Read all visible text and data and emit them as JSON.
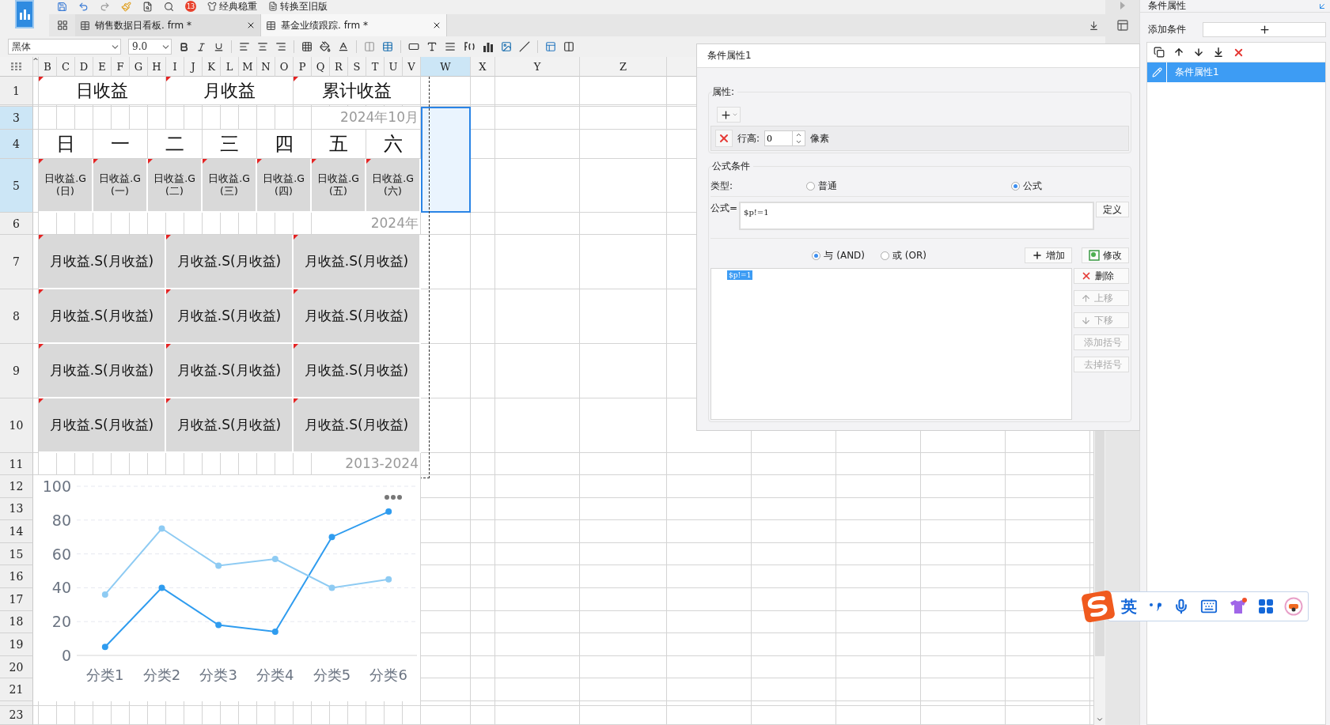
{
  "app_toolbar": {
    "badge": "13",
    "theme_button": "经典稳重",
    "legacy_button": "转换至旧版"
  },
  "tabs": [
    {
      "label": "销售数据日看板. frm *",
      "selected": false
    },
    {
      "label": "基金业绩跟踪. frm *",
      "selected": true
    }
  ],
  "format_toolbar": {
    "font": "黑体",
    "size": "9.0"
  },
  "sheet": {
    "columns": [
      {
        "label": "^",
        "selected": false
      },
      {
        "label": "B",
        "selected": false
      },
      {
        "label": "C",
        "selected": false
      },
      {
        "label": "D",
        "selected": false
      },
      {
        "label": "E",
        "selected": false
      },
      {
        "label": "F",
        "selected": false
      },
      {
        "label": "G",
        "selected": false
      },
      {
        "label": "H",
        "selected": false
      },
      {
        "label": "I",
        "selected": false
      },
      {
        "label": "J",
        "selected": false
      },
      {
        "label": "K",
        "selected": false
      },
      {
        "label": "L",
        "selected": false
      },
      {
        "label": "M",
        "selected": false
      },
      {
        "label": "N",
        "selected": false
      },
      {
        "label": "O",
        "selected": false
      },
      {
        "label": "P",
        "selected": false
      },
      {
        "label": "Q",
        "selected": false
      },
      {
        "label": "R",
        "selected": false
      },
      {
        "label": "S",
        "selected": false
      },
      {
        "label": "T",
        "selected": false
      },
      {
        "label": "U",
        "selected": false
      },
      {
        "label": "V",
        "selected": false
      },
      {
        "label": "W",
        "selected": true
      },
      {
        "label": "X",
        "selected": false
      },
      {
        "label": "Y",
        "selected": false
      },
      {
        "label": "Z",
        "selected": false
      }
    ],
    "rows": [
      {
        "label": "1",
        "selected": false
      },
      {
        "label": "3",
        "selected": true
      },
      {
        "label": "4",
        "selected": true
      },
      {
        "label": "5",
        "selected": true
      },
      {
        "label": "6",
        "selected": false
      },
      {
        "label": "7",
        "selected": false
      },
      {
        "label": "8",
        "selected": false
      },
      {
        "label": "9",
        "selected": false
      },
      {
        "label": "10",
        "selected": false
      },
      {
        "label": "11",
        "selected": false
      },
      {
        "label": "12",
        "selected": false
      },
      {
        "label": "13",
        "selected": false
      },
      {
        "label": "14",
        "selected": false
      },
      {
        "label": "15",
        "selected": false
      },
      {
        "label": "16",
        "selected": false
      },
      {
        "label": "17",
        "selected": false
      },
      {
        "label": "18",
        "selected": false
      },
      {
        "label": "19",
        "selected": false
      },
      {
        "label": "20",
        "selected": false
      },
      {
        "label": "21",
        "selected": false
      },
      {
        "label": "23",
        "selected": false
      }
    ],
    "titles": [
      "日收益",
      "月收益",
      "累计收益"
    ],
    "month_label": "2024年10月",
    "weekdays": [
      "日",
      "一",
      "二",
      "三",
      "四",
      "五",
      "六"
    ],
    "daily_cells": [
      "日收益.G(日)",
      "日收益.G(一)",
      "日收益.G(二)",
      "日收益.G(三)",
      "日收益.G(四)",
      "日收益.G(五)",
      "日收益.G(六)"
    ],
    "year_label": "2024年",
    "monthly_rows": [
      [
        "月收益.S(月收益)",
        "月收益.S(月收益)",
        "月收益.S(月收益)"
      ],
      [
        "月收益.S(月收益)",
        "月收益.S(月收益)",
        "月收益.S(月收益)"
      ],
      [
        "月收益.S(月收益)",
        "月收益.S(月收益)",
        "月收益.S(月收益)"
      ],
      [
        "月收益.S(月收益)",
        "月收益.S(月收益)",
        "月收益.S(月收益)"
      ]
    ],
    "range_label": "2013-2024",
    "chart_data": {
      "type": "line",
      "categories": [
        "分类1",
        "分类2",
        "分类3",
        "分类4",
        "分类5",
        "分类6"
      ],
      "series": [
        {
          "color": "#2f9cef",
          "marker": "circle",
          "values": [
            5,
            40,
            18,
            14,
            70,
            85
          ]
        },
        {
          "color": "#8ecbf3",
          "marker": "circle",
          "values": [
            36,
            75,
            53,
            57,
            40,
            45
          ]
        }
      ],
      "grid": true,
      "ylim": [
        0,
        100
      ],
      "yticks": [
        0,
        20,
        40,
        60,
        80,
        100
      ]
    }
  },
  "dialog": {
    "title": "条件属性1",
    "attributes_legend": "属性:",
    "row_height_label": "行高:",
    "row_height_value": "0",
    "row_height_unit": "像素",
    "formula_legend": "公式条件",
    "type_label": "类型:",
    "types": [
      {
        "label": "普通",
        "selected": false
      },
      {
        "label": "公式",
        "selected": true
      }
    ],
    "formula_label": "公式=",
    "formula": "$p!=1",
    "define_button": "定义",
    "logic": [
      {
        "label": "与 (AND)",
        "selected": true
      },
      {
        "label": "或 (OR)",
        "selected": false
      }
    ],
    "add_button": "增加",
    "modify_button": "修改",
    "conditions": [
      {
        "label": "$p!=1",
        "selected": true
      }
    ],
    "actions": [
      {
        "label": "删除",
        "kind": "delete",
        "disabled": false
      },
      {
        "label": "上移",
        "kind": "up",
        "disabled": true
      },
      {
        "label": "下移",
        "kind": "down",
        "disabled": true
      },
      {
        "label": "添加括号",
        "kind": "add-brackets",
        "disabled": true
      },
      {
        "label": "去掉括号",
        "kind": "remove-brackets",
        "disabled": true
      }
    ]
  },
  "right_panel": {
    "title": "条件属性",
    "add_label": "添加条件",
    "items": [
      {
        "label": "条件属性1",
        "selected": true
      }
    ]
  },
  "ime": {
    "mode": "英"
  }
}
